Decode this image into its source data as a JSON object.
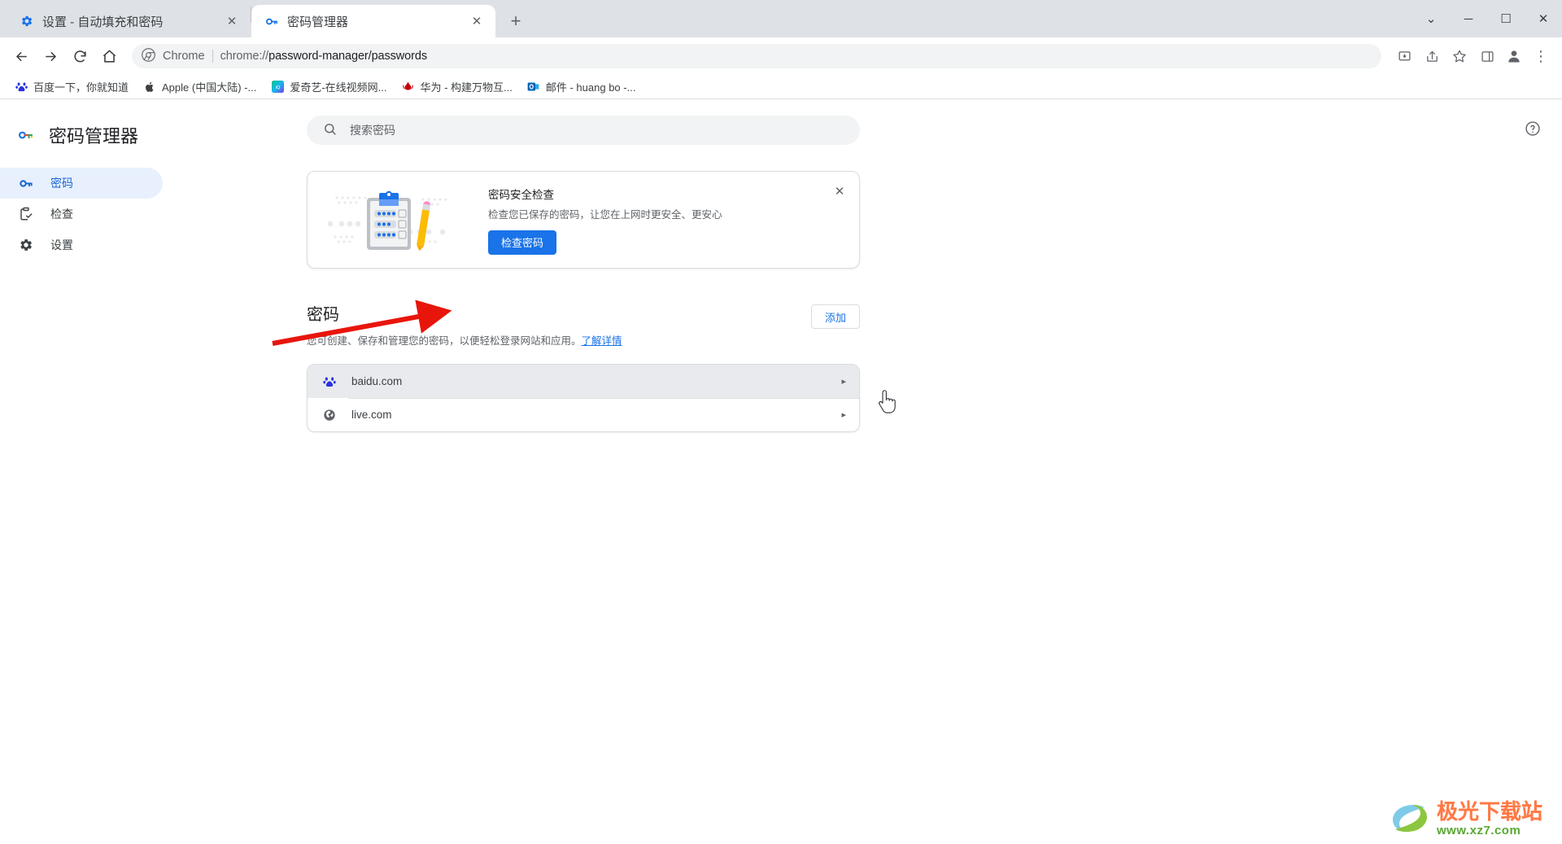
{
  "window": {
    "minimize_label": "─",
    "maximize_label": "☐",
    "close_label": "✕",
    "caret_label": "⌄"
  },
  "tabs": [
    {
      "title": "设置 - 自动填充和密码",
      "favicon": "gear-icon",
      "active": false,
      "close_label": "✕"
    },
    {
      "title": "密码管理器",
      "favicon": "key-icon",
      "active": true,
      "close_label": "✕"
    }
  ],
  "newtab_label": "+",
  "toolbar": {
    "back_label": "←",
    "forward_label": "→",
    "reload_label": "↻",
    "home_label": "⌂",
    "omnibox": {
      "brand": "Chrome",
      "url_prefix": "chrome://",
      "url_main": "password-manager/passwords",
      "full_url": "chrome://password-manager/passwords"
    },
    "install_label": "install-icon",
    "share_label": "share-icon",
    "bookmark_label": "☆",
    "sidepanel_label": "sidepanel-icon",
    "profile_label": "profile-avatar",
    "menu_label": "⋮"
  },
  "bookmarks": [
    {
      "label": "百度一下，你就知道",
      "icon": "baidu-icon"
    },
    {
      "label": "Apple (中国大陆) -...",
      "icon": "apple-icon"
    },
    {
      "label": "爱奇艺-在线视频网...",
      "icon": "iqiyi-icon"
    },
    {
      "label": "华为 - 构建万物互...",
      "icon": "huawei-icon"
    },
    {
      "label": "邮件 - huang bo -...",
      "icon": "outlook-icon"
    }
  ],
  "sidebar": {
    "brand_title": "密码管理器",
    "items": [
      {
        "label": "密码",
        "icon": "key-icon",
        "selected": true
      },
      {
        "label": "检查",
        "icon": "checkup-icon",
        "selected": false
      },
      {
        "label": "设置",
        "icon": "gear-icon",
        "selected": false
      }
    ]
  },
  "search": {
    "placeholder": "搜索密码",
    "icon": "search-icon"
  },
  "help": {
    "label": "?"
  },
  "checkup_card": {
    "title": "密码安全检查",
    "description": "检查您已保存的密码，让您在上网时更安全、更安心",
    "button_label": "检查密码",
    "close_label": "✕"
  },
  "passwords_section": {
    "title": "密码",
    "description": "您可创建、保存和管理您的密码，以便轻松登录网站和应用。",
    "learn_more": "了解详情",
    "add_label": "添加",
    "entries": [
      {
        "site": "baidu.com",
        "icon": "baidu-favicon",
        "hovered": true,
        "chevron": "▸"
      },
      {
        "site": "live.com",
        "icon": "globe-favicon",
        "hovered": false,
        "chevron": "▸"
      }
    ]
  },
  "watermark": {
    "main": "极光下载站",
    "sub": "www.xz7.com"
  },
  "colors": {
    "accent": "#1a73e8",
    "selected_bg": "#e8f0fe",
    "selected_fg": "#1967d2",
    "annotation_arrow": "#e8150c",
    "tabstrip_bg": "#dee1e6",
    "row_hover": "#e8eaed"
  }
}
